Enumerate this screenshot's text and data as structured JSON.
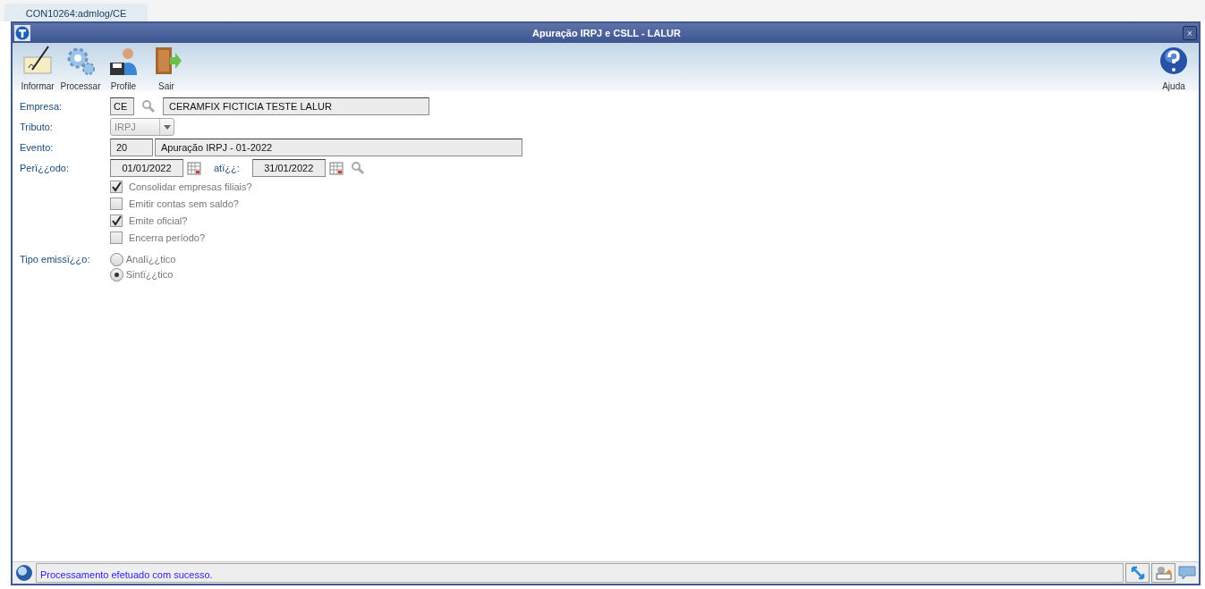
{
  "tabs": [
    {
      "label": "CON10264:admlog/CE",
      "selected": true
    }
  ],
  "window": {
    "title": "Apuração IRPJ e CSLL - LALUR",
    "close": "×"
  },
  "toolbar": [
    {
      "kind": "write",
      "label": "Informar"
    },
    {
      "kind": "gears",
      "label": "Processar"
    },
    {
      "kind": "profile",
      "label": "Profile"
    },
    {
      "kind": "exit",
      "label": "Sair"
    },
    {
      "kind": "help",
      "label": "Ajuda"
    }
  ],
  "form": {
    "empresa": {
      "label": "Empresa:",
      "code": "CE",
      "name": "CERAMFIX FICTICIA TESTE LALUR"
    },
    "tributo": {
      "label": "Tributo:",
      "value": "IRPJ"
    },
    "evento": {
      "label": "Evento:",
      "code": "20",
      "description": "Apuração IRPJ - 01-2022"
    },
    "periodo": {
      "label": "Perï¿¿odo:",
      "from": "01/01/2022",
      "to_label": "atï¿¿:",
      "to": "31/01/2022"
    },
    "checkboxes": [
      {
        "label": "Consolidar empresas filiais?",
        "checked": true
      },
      {
        "label": "Emitir contas sem saldo?",
        "checked": false
      },
      {
        "label": "Emite oficial?",
        "checked": true
      },
      {
        "label": "Encerra período?",
        "checked": false
      }
    ],
    "tipo_emissao": {
      "label": "Tipo emissï¿¿o:",
      "options": [
        {
          "label": "Analï¿¿tico",
          "selected": false
        },
        {
          "label": "Sintï¿¿tico",
          "selected": true
        }
      ]
    }
  },
  "status_bar": {
    "message": "Processamento efetuado com sucesso."
  }
}
